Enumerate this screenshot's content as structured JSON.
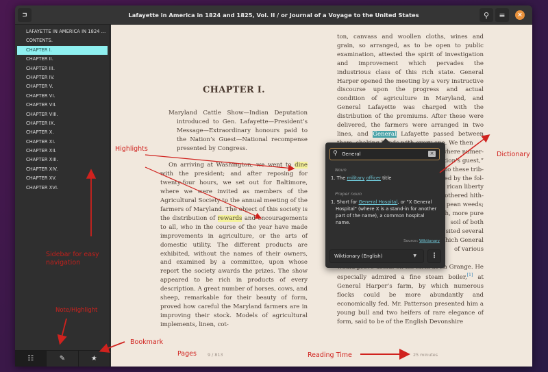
{
  "window": {
    "title": "Lafayette in America in 1824 and 1825, Vol. II / or Journal of a Voyage to the United States",
    "icons": {
      "app": "book-sidebar-icon",
      "search": "search-icon",
      "menu": "hamburger-menu-icon",
      "close": "close-icon"
    }
  },
  "sidebar": {
    "toc": [
      {
        "label": "LAFAYETTE IN AMERICA IN 1824 ...",
        "active": false
      },
      {
        "label": "CONTENTS.",
        "active": false
      },
      {
        "label": "CHAPTER I.",
        "active": true
      },
      {
        "label": "CHAPTER II.",
        "active": false
      },
      {
        "label": "CHAPTER III.",
        "active": false
      },
      {
        "label": "CHAPTER IV.",
        "active": false
      },
      {
        "label": "CHAPTER V.",
        "active": false
      },
      {
        "label": "CHAPTER VI.",
        "active": false
      },
      {
        "label": "CHAPTER VII.",
        "active": false
      },
      {
        "label": "CHAPTER VIII.",
        "active": false
      },
      {
        "label": "CHAPTER IX.",
        "active": false
      },
      {
        "label": "CHAPTER X.",
        "active": false
      },
      {
        "label": "CHAPTER XI.",
        "active": false
      },
      {
        "label": "CHAPTER XII.",
        "active": false
      },
      {
        "label": "CHAPTER XIII.",
        "active": false
      },
      {
        "label": "CHAPTER XIV.",
        "active": false
      },
      {
        "label": "CHAPTER XV.",
        "active": false
      },
      {
        "label": "CHAPTER XVI.",
        "active": false
      }
    ],
    "bottom_tabs": [
      {
        "name": "contents",
        "icon": "list-icon",
        "glyph": "☷",
        "active": true
      },
      {
        "name": "annotations",
        "icon": "pencil-icon",
        "glyph": "✎",
        "active": false
      },
      {
        "name": "bookmarks",
        "icon": "star-icon",
        "glyph": "★",
        "active": false
      }
    ]
  },
  "book": {
    "chapter_title": "CHAPTER I.",
    "summary": "Maryland Cattle Show—Indian Deputation introduced to Gen. Lafayette—President’s Message—Extraordinary honours paid to the Nation’s Guest—National recompense presented by Congress.",
    "left_para": {
      "a": "On arriving at Washington, we went to ",
      "hl1": "dine",
      "b": " with the president; and after reposing for twenty-four hours, we set out for Baltimore, where we were invited as members of the Agricultural Society to the annual meeting of the farmers of Maryland. The object of this society is the distribution of ",
      "hl2": "rewards",
      "c": " and encouragements to all, who in the course of the year have made improvements in agriculture, or the arts of domestic utility. The different products are exhibited, without the names of their owners, and examined by a committee, upon whose report the society awards the prizes. The show appeared to be rich in products of every description. A great number of horses, cows, and sheep, remarkable for their beauty of form, proved how careful the Maryland farmers are in improving their stock. Models of agricultural implements, linen, cot-"
    },
    "right_top": {
      "a": "ton, canvass and woollen cloths, wines and grain, so arranged, as to be open to public examination, attested the spirit of investigation and improvement which pervades the industrious class of this rich state. General Harper opened the meeting by a very instructive discourse upon the progress and actual condition of agriculture in Maryland, and General Lafayette was charged with the distribution of the premiums. After these were delivered, the farmers were arranged in two lines, and ",
      "selected": "General",
      "b": " Lafayette passed between them, shaking hands with every one. We then"
    },
    "right_hidden_fragments": [
      "where numer-",
      "tion’s guest,”",
      "to these trib-",
      "ed by the fol-",
      "rican liberty",
      "othered hith-",
      "pean weeds;",
      "h, more pure",
      "soil of both"
    ],
    "right_bottom": {
      "a": "visited several farms, among which General ... of various improvements, whose application he thought would prove useful on his farm at La Grange. He especially admired a fine steam boiler,",
      "footnote": "[1]",
      "b": " at General Harper’s farm, by which numerous flocks could be more abundantly and economically fed. Mr. Patterson presented him a young bull and two heifers of rare elegance of form, said to be of the English Devonshire"
    },
    "right_visible_partial": [
      "sited several",
      "hich General",
      "of various"
    ],
    "page_indicator": "9 / 813",
    "reading_time": "25 minutes"
  },
  "dictionary": {
    "search_value": "General",
    "entries": [
      {
        "pos": "Noun",
        "def_prefix": "1. The ",
        "links": [
          "military",
          "officer"
        ],
        "def_suffix": " title"
      },
      {
        "pos": "Proper noun",
        "def_prefix": "1. Short for ",
        "links": [
          "General Hospital"
        ],
        "def_suffix": ", or \"X General Hospital\" (where X is a stand-in for another part of the name), a common hospital name."
      }
    ],
    "source_label": "Source: ",
    "source_link": "Wiktionary",
    "selected_source": "Wiktionary (English)"
  },
  "annotations": {
    "highlights": "Highlights",
    "dictionary": "Dictionary",
    "sidebar_line1": "Sidebar for easy",
    "sidebar_line2": "navigation",
    "note_highlight": "Note/Highlight",
    "bookmark": "Bookmark",
    "pages": "Pages",
    "reading_time": "Reading Time"
  },
  "colors": {
    "accent_active_toc": "#8ff0f0",
    "highlight": "#f4f29a",
    "selection": "#4aa3a8",
    "close_button": "#e8913c",
    "annotation_red": "#d0221e",
    "page_bg": "#f1e8dd"
  }
}
